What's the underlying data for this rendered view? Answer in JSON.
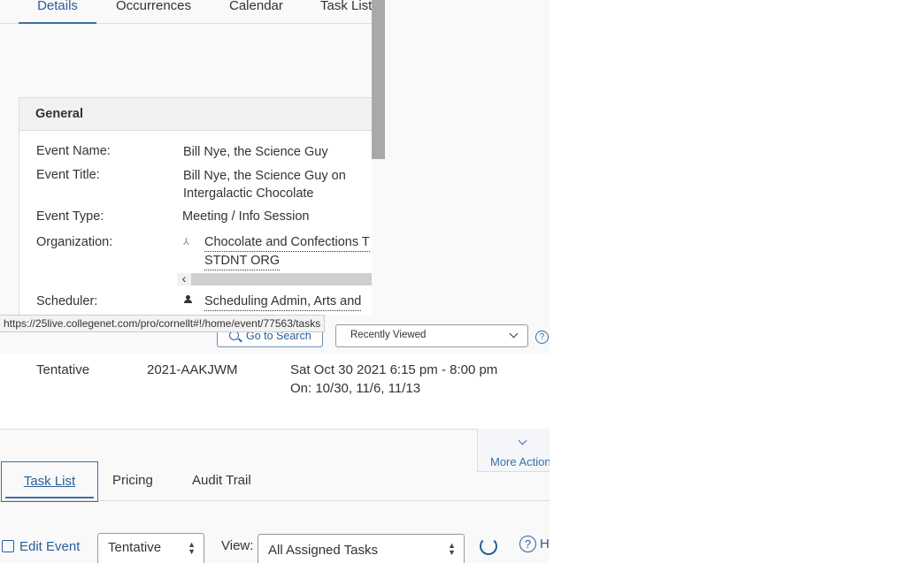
{
  "front": {
    "tabs": [
      "Details",
      "Occurrences",
      "Calendar",
      "Task List"
    ],
    "panel_title": "General",
    "fields": {
      "event_name_label": "Event Name:",
      "event_name": "Bill Nye, the Science Guy",
      "event_title_label": "Event Title:",
      "event_title_line1": "Bill Nye, the Science Guy on",
      "event_title_line2": "Intergalactic Chocolate",
      "event_type_label": "Event Type:",
      "event_type": "Meeting / Info Session",
      "organization_label": "Organization:",
      "organization_line1": "Chocolate and Confections T",
      "organization_line2": "STDNT ORG",
      "scheduler_label": "Scheduler:",
      "scheduler": "Scheduling Admin, Arts and"
    },
    "scroll_left": "‹"
  },
  "status_bar": {
    "url": "https://25live.collegenet.com/pro/cornellt#!/home/event/77563/tasks"
  },
  "back": {
    "go_to_search": "Go to Search",
    "recently_viewed": "Recently Viewed",
    "help": "?",
    "row": {
      "state": "Tentative",
      "reference": "2021-AAKJWM",
      "date": "Sat Oct 30 2021 6:15 pm - 8:00 pm",
      "occurrences": "On: 10/30, 11/6, 11/13"
    },
    "more_actions": "More Actions",
    "lower_tabs": [
      "Task List",
      "Pricing",
      "Audit Trail"
    ],
    "edit_event": "Edit Event",
    "state_select": "Tentative",
    "view_label": "View:",
    "view_select": "All Assigned Tasks",
    "help_label": "H"
  },
  "colors": {
    "accent": "#2a5d99",
    "scrollbar": "#a9a9a9"
  }
}
